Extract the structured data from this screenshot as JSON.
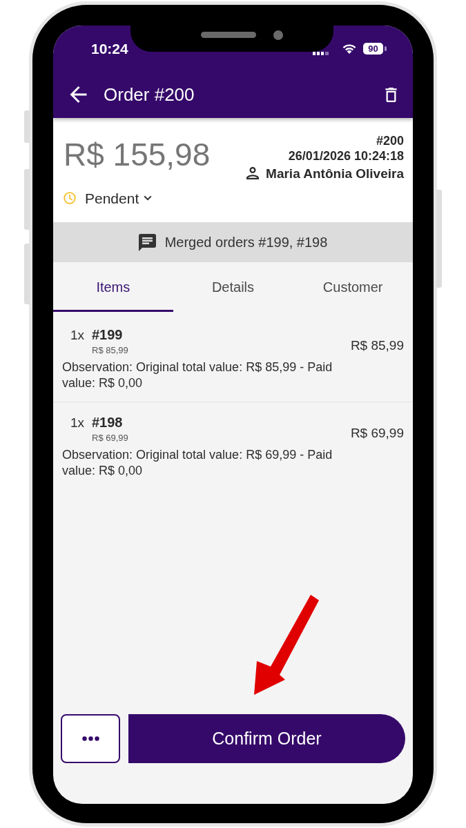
{
  "status_bar": {
    "time": "10:24",
    "battery": "90"
  },
  "app_bar": {
    "title": "Order #200"
  },
  "summary": {
    "total": "R$ 155,98",
    "order_number": "#200",
    "datetime": "26/01/2026 10:24:18",
    "customer": "Maria Antônia Oliveira",
    "status": "Pendent"
  },
  "merged_notice": {
    "text": "Merged orders #199, #198"
  },
  "tabs": [
    {
      "label": "Items",
      "selected": true
    },
    {
      "label": "Details",
      "selected": false
    },
    {
      "label": "Customer",
      "selected": false
    }
  ],
  "items": [
    {
      "quantity": "1x",
      "name": "#199",
      "unit_price": "R$ 85,99",
      "observation": "Observation: Original total value: R$ 85,99 - Paid value: R$ 0,00",
      "total": "R$ 85,99"
    },
    {
      "quantity": "1x",
      "name": "#198",
      "unit_price": "R$ 69,99",
      "observation": "Observation: Original total value: R$ 69,99 - Paid value: R$ 0,00",
      "total": "R$ 69,99"
    }
  ],
  "actions": {
    "confirm": "Confirm Order"
  }
}
